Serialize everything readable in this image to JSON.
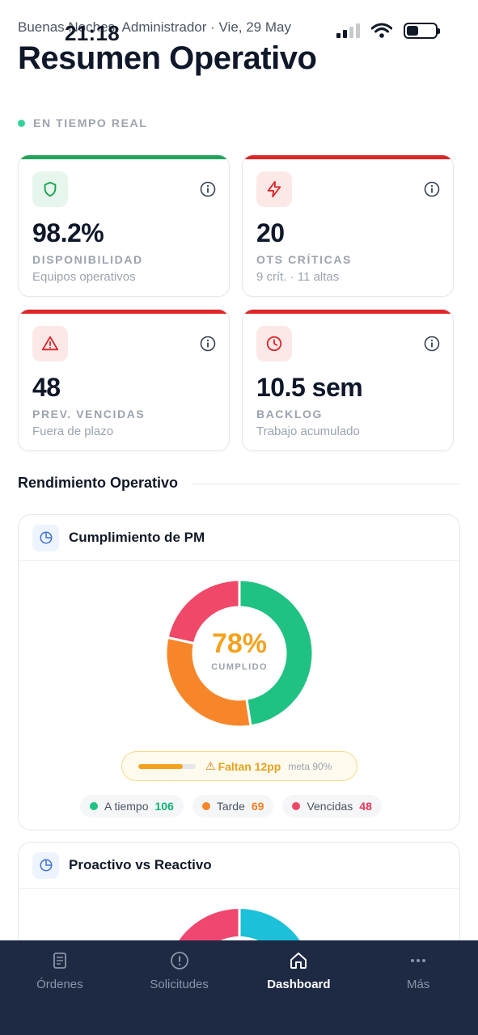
{
  "status": {
    "time": "21:18"
  },
  "header": {
    "greeting": "Buenas Noches, Administrador · Vie, 29 May",
    "title": "Resumen Operativo"
  },
  "live": {
    "label": "EN TIEMPO REAL",
    "dot_color": "#34d399"
  },
  "kpis": [
    {
      "icon": "shield-icon",
      "value": "98.2%",
      "label": "DISPONIBILIDAD",
      "sub": "Equipos operativos",
      "accent": "#22a55b",
      "icon_bg": "#e6f6ec",
      "icon_color": "#16a34a"
    },
    {
      "icon": "lightning-icon",
      "value": "20",
      "label": "OTS CRÍTICAS",
      "sub": "9 crít. · 11 altas",
      "accent": "#dc2626",
      "icon_bg": "#fde8e8",
      "icon_color": "#dc2626"
    },
    {
      "icon": "warning-triangle-icon",
      "value": "48",
      "label": "PREV. VENCIDAS",
      "sub": "Fuera de plazo",
      "accent": "#dc2626",
      "icon_bg": "#fde8e8",
      "icon_color": "#dc2626"
    },
    {
      "icon": "clock-icon",
      "value": "10.5 sem",
      "label": "BACKLOG",
      "sub": "Trabajo acumulado",
      "accent": "#dc2626",
      "icon_bg": "#fde8e8",
      "icon_color": "#dc2626"
    }
  ],
  "section": {
    "title": "Rendimiento Operativo"
  },
  "pm_card": {
    "title": "Cumplimiento de PM",
    "icon": "pie-chart-icon",
    "donut_pct": "78%",
    "donut_caption": "CUMPLIDO",
    "gap_text": "Faltan 12pp",
    "gap_meta": "meta 90%",
    "gap_fill": 0.78,
    "legend": [
      {
        "label": "A tiempo",
        "value": "106",
        "color": "#1fc283"
      },
      {
        "label": "Tarde",
        "value": "69",
        "color": "#f7862a"
      },
      {
        "label": "Vencidas",
        "value": "48",
        "color": "#f04868"
      }
    ]
  },
  "chart_data": {
    "type": "pie",
    "categories": [
      "A tiempo",
      "Tarde",
      "Vencidas"
    ],
    "values": [
      106,
      69,
      48
    ],
    "colors": [
      "#1fc283",
      "#f7862a",
      "#f04868"
    ],
    "center_label": "78%",
    "center_caption": "CUMPLIDO"
  },
  "pr_card": {
    "title": "Proactivo vs Reactivo",
    "icon": "pie-chart-icon",
    "colors": [
      "#1cc0d8",
      "#ef476f"
    ]
  },
  "nav": {
    "items": [
      {
        "label": "Órdenes",
        "icon": "clipboard-icon"
      },
      {
        "label": "Solicitudes",
        "icon": "alert-circle-icon"
      },
      {
        "label": "Dashboard",
        "icon": "home-icon"
      },
      {
        "label": "Más",
        "icon": "more-dots-icon"
      }
    ],
    "active": "Dashboard"
  }
}
